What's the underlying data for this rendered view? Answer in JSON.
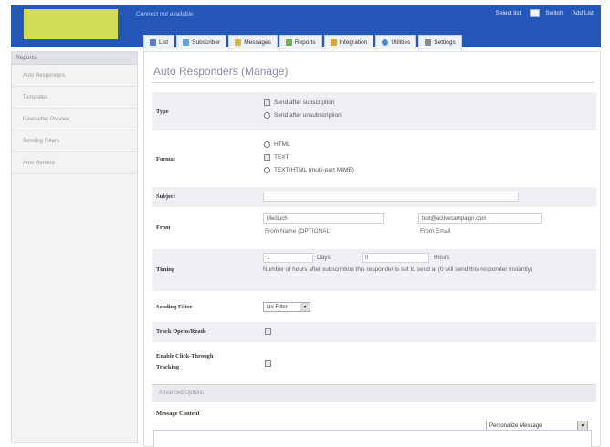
{
  "header": {
    "connected_text": "Connect not available",
    "links": [
      "Select list",
      "Switch",
      "Add List"
    ]
  },
  "colors": {
    "header_bg": "#2457b8",
    "logo": "#cfdd57",
    "sidebar_bg": "#f3f3f3",
    "row_shade": "#eff0f3"
  },
  "tabs": [
    {
      "label": "List",
      "icon": "list-icon"
    },
    {
      "label": "Subscriber",
      "icon": "users-icon"
    },
    {
      "label": "Messages",
      "icon": "pencil-icon"
    },
    {
      "label": "Reports",
      "icon": "chart-icon"
    },
    {
      "label": "Integration",
      "icon": "plug-icon"
    },
    {
      "label": "Utilities",
      "icon": "globe-icon"
    },
    {
      "label": "Settings",
      "icon": "wrench-icon"
    }
  ],
  "sidebar": {
    "header": "Reports",
    "items": [
      "Auto Responders",
      "Templates",
      "Newsletter Preview",
      "Sending Filters",
      "Auto Remind"
    ]
  },
  "page": {
    "title": "Auto Responders (Manage)"
  },
  "form": {
    "type": {
      "label": "Type",
      "options": [
        "Send after subscription",
        "Send after unsubscription"
      ]
    },
    "format": {
      "label": "Format",
      "options": [
        "HTML",
        "TEXT",
        "TEXT/HTML (multi-part MIME)"
      ]
    },
    "subject": {
      "label": "Subject",
      "value": ""
    },
    "from": {
      "label": "From",
      "name_value": "Mediuch",
      "name_caption": "From Name (OPTIONAL)",
      "email_value": "test@activecampaign.com",
      "email_caption": "From Email"
    },
    "timing": {
      "label": "Timing",
      "days_value": "1",
      "days_label": "Days",
      "hours_value": "0",
      "hours_label": "Hours",
      "help": "Number of hours after subscription this responder is set to send at (0 will send this responder instantly)"
    },
    "sending_filter": {
      "label": "Sending Filter",
      "selected": "No Filter"
    },
    "track_opens": {
      "label": "Track Opens/Reads"
    },
    "track_clicks": {
      "label_line1": "Enable Click-Through",
      "label_line2": "Tracking"
    },
    "advanced": {
      "label": "Advanced Options"
    },
    "message_content": {
      "label": "Message Content",
      "personalize": "Personalize Message"
    }
  }
}
